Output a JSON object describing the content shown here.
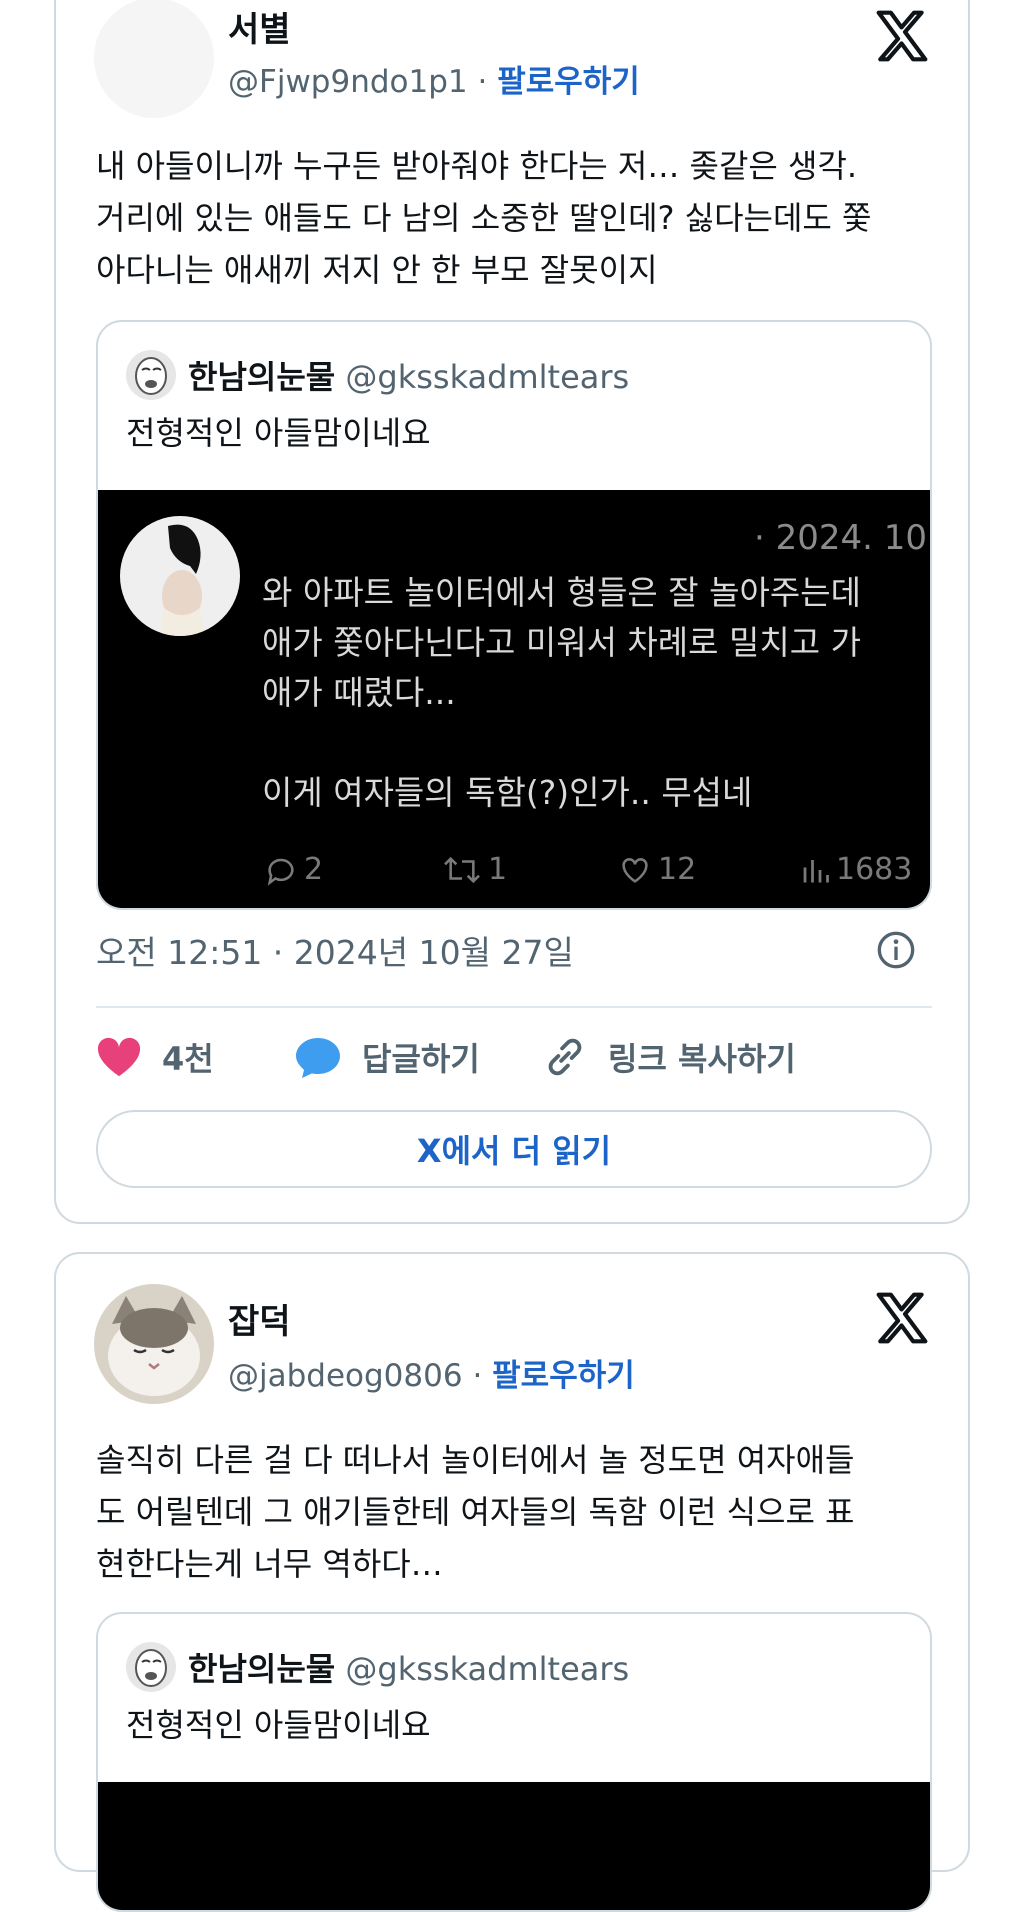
{
  "tweets": [
    {
      "name": "서별",
      "handle": "@Fjwp9ndo1p1",
      "separator": "·",
      "follow_label": "팔로우하기",
      "body_lines": [
        "내 아들이니까 누구든 받아줘야 한다는 저… 좆같은 생각.",
        "거리에 있는 애들도 다 남의 소중한 딸인데? 싫다는데도 쫓",
        "아다니는 애새끼 저지 안 한 부모 잘못이지"
      ],
      "quote": {
        "name": "한남의눈물",
        "handle": "@gksskadmltears",
        "text": "전형적인 아들맘이네요",
        "media": {
          "date": "· 2024. 10",
          "lines": [
            "와 아파트 놀이터에서 형들은 잘 놀아주는데",
            "애가 쫓아다닌다고 미워서 차례로 밀치고 가",
            "애가 때렸다...",
            "",
            "이게 여자들의 독함(?)인가.. 무섭네"
          ],
          "stats": {
            "replies": "2",
            "retweets": "1",
            "likes": "12",
            "views": "1683"
          }
        }
      },
      "timestamp": "오전 12:51 · 2024년 10월 27일",
      "likes": "4천",
      "reply_label": "답글하기",
      "copy_link_label": "링크 복사하기",
      "read_more_label": "X에서 더 읽기"
    },
    {
      "name": "잡덕",
      "handle": "@jabdeog0806",
      "separator": "·",
      "follow_label": "팔로우하기",
      "body_lines": [
        "솔직히 다른 걸 다 떠나서 놀이터에서 놀 정도면 여자애들",
        "도 어릴텐데 그 애기들한테 여자들의 독함 이런 식으로 표",
        "현한다는게 너무 역하다…"
      ],
      "quote": {
        "name": "한남의눈물",
        "handle": "@gksskadmltears",
        "text": "전형적인 아들맘이네요"
      }
    }
  ],
  "colors": {
    "accent": "#1d64c8",
    "like": "#e8407a",
    "reply": "#3f9df0",
    "border": "#cfd9de"
  },
  "icons": [
    "x-logo-icon",
    "info-icon",
    "heart-icon",
    "speech-bubble-icon",
    "link-icon",
    "reply-icon",
    "retweet-icon",
    "like-icon",
    "views-icon"
  ]
}
